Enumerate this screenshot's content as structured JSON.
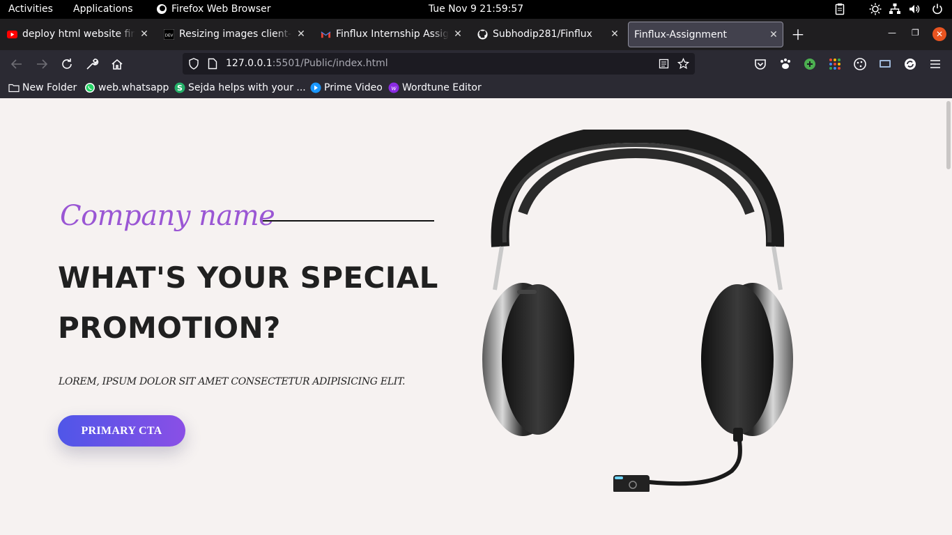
{
  "system_bar": {
    "activities": "Activities",
    "applications": "Applications",
    "app_name": "Firefox Web Browser",
    "clock": "Tue Nov 9  21:59:57",
    "tray_icons": [
      "clipboard-icon",
      "brightness-icon",
      "network-icon",
      "volume-icon",
      "power-icon"
    ]
  },
  "tabs": [
    {
      "label": "deploy html website firebase",
      "icon": "youtube-icon",
      "active": false
    },
    {
      "label": "Resizing images client-side",
      "icon": "dev-icon",
      "active": false
    },
    {
      "label": "Finflux Internship Assignment",
      "icon": "gmail-icon",
      "active": false
    },
    {
      "label": "Subhodip281/Finflux",
      "icon": "github-icon",
      "active": false
    },
    {
      "label": "Finflux-Assignment",
      "icon": "",
      "active": true
    }
  ],
  "tab_close_glyph": "✕",
  "url": {
    "host": "127.0.0.1",
    "rest": ":5501/Public/index.html"
  },
  "bookmarks": [
    {
      "label": "New Folder",
      "icon": "folder-icon"
    },
    {
      "label": "web.whatsapp",
      "icon": "whatsapp-icon"
    },
    {
      "label": "Sejda helps with your ...",
      "icon": "sejda-icon"
    },
    {
      "label": "Prime Video",
      "icon": "prime-video-icon"
    },
    {
      "label": "Wordtune Editor",
      "icon": "wordtune-icon"
    }
  ],
  "page": {
    "company_name": "Company name",
    "headline": "WHAT'S YOUR SPECIAL PROMOTION?",
    "subtext": "LOREM, IPSUM DOLOR SIT AMET CONSECTETUR ADIPISICING ELIT.",
    "cta_label": "PRIMARY CTA",
    "image": "headphones-with-microphone"
  },
  "colors": {
    "company_name": "#9a56d4",
    "cta_gradient_start": "#4f56e8",
    "cta_gradient_end": "#8a4fe6",
    "page_background": "#f6f2f1",
    "close_button": "#e95420"
  }
}
